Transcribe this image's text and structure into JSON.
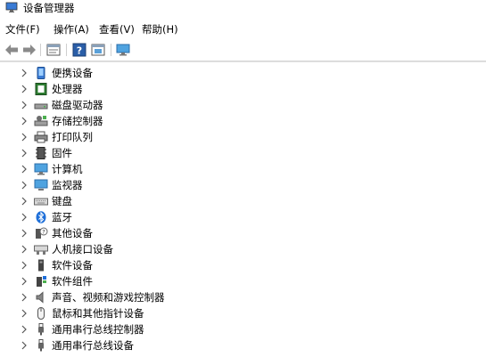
{
  "window": {
    "title": "设备管理器"
  },
  "menu": [
    {
      "label": "文件(F)"
    },
    {
      "label": "操作(A)"
    },
    {
      "label": "查看(V)"
    },
    {
      "label": "帮助(H)"
    }
  ],
  "toolbar": {
    "buttons": [
      {
        "icon": "back-arrow-icon"
      },
      {
        "icon": "forward-arrow-icon"
      },
      {
        "icon": "properties-icon"
      },
      {
        "icon": "help-icon"
      },
      {
        "icon": "view-icon"
      },
      {
        "icon": "monitor-scan-icon"
      }
    ]
  },
  "tree": {
    "items": [
      {
        "label": "便携设备",
        "icon": "portable-device-icon"
      },
      {
        "label": "处理器",
        "icon": "processor-icon"
      },
      {
        "label": "磁盘驱动器",
        "icon": "disk-drive-icon"
      },
      {
        "label": "存储控制器",
        "icon": "storage-controller-icon"
      },
      {
        "label": "打印队列",
        "icon": "printer-icon"
      },
      {
        "label": "固件",
        "icon": "firmware-icon"
      },
      {
        "label": "计算机",
        "icon": "computer-icon"
      },
      {
        "label": "监视器",
        "icon": "monitor-icon"
      },
      {
        "label": "键盘",
        "icon": "keyboard-icon"
      },
      {
        "label": "蓝牙",
        "icon": "bluetooth-icon"
      },
      {
        "label": "其他设备",
        "icon": "other-device-icon"
      },
      {
        "label": "人机接口设备",
        "icon": "hid-icon"
      },
      {
        "label": "软件设备",
        "icon": "software-device-icon"
      },
      {
        "label": "软件组件",
        "icon": "software-component-icon"
      },
      {
        "label": "声音、视频和游戏控制器",
        "icon": "sound-icon"
      },
      {
        "label": "鼠标和其他指针设备",
        "icon": "mouse-icon"
      },
      {
        "label": "通用串行总线控制器",
        "icon": "usb-icon"
      },
      {
        "label": "通用串行总线设备",
        "icon": "usb-icon"
      }
    ]
  }
}
